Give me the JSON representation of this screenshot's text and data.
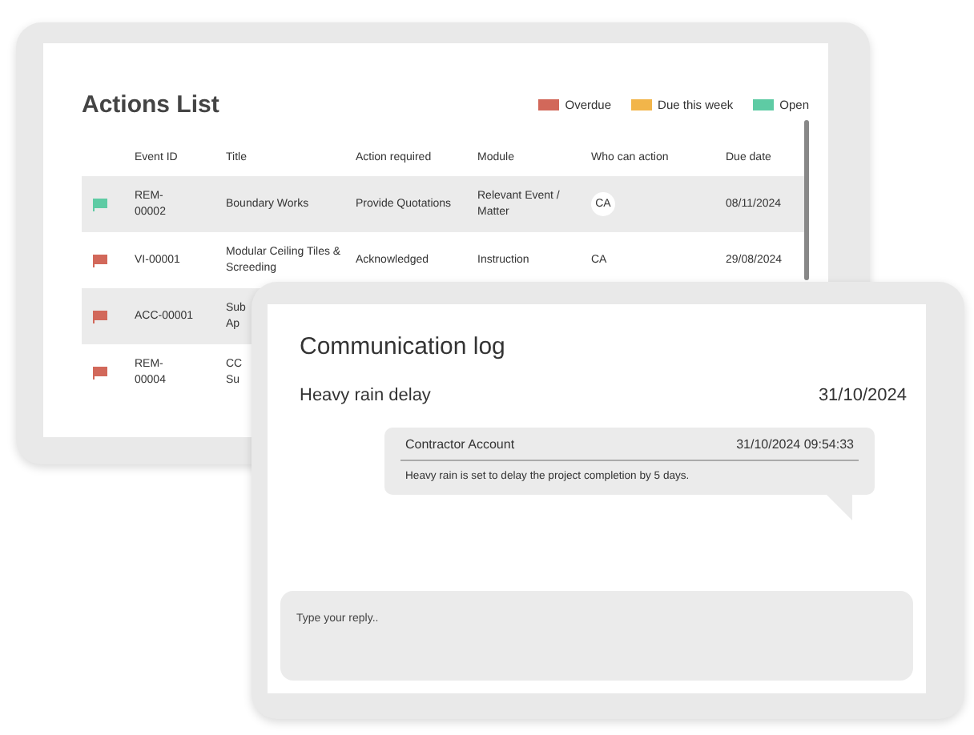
{
  "actions_list": {
    "title": "Actions List",
    "legend": [
      {
        "label": "Overdue",
        "color": "#d2685a"
      },
      {
        "label": "Due this week",
        "color": "#f2b54a"
      },
      {
        "label": "Open",
        "color": "#5ecba4"
      }
    ],
    "columns": [
      "Event ID",
      "Title",
      "Action required",
      "Module",
      "Who can action",
      "Due date"
    ],
    "rows": [
      {
        "color": "#5ecba4",
        "event_id": "REM-\n00002",
        "title": "Boundary Works",
        "action": "Provide Quotations",
        "module": "Relevant Event / Matter",
        "who": "CA",
        "who_badge": true,
        "due": "08/11/2024"
      },
      {
        "color": "#d2685a",
        "event_id": "VI-00001",
        "title": "Modular Ceiling Tiles & Screeding",
        "action": "Acknowledged",
        "module": "Instruction",
        "who": "CA",
        "who_badge": false,
        "due": "29/08/2024"
      },
      {
        "color": "#d2685a",
        "event_id": "ACC-00001",
        "title": "Sub\nAp"
      },
      {
        "color": "#d2685a",
        "event_id": "REM-\n00004",
        "title": "CC\nSu"
      }
    ]
  },
  "communication_log": {
    "title": "Communication log",
    "subject": "Heavy rain delay",
    "date": "31/10/2024",
    "messages": [
      {
        "author": "Contractor Account",
        "timestamp": "31/10/2024 09:54:33",
        "text": "Heavy rain is set to delay the project completion by 5 days."
      }
    ],
    "reply": {
      "placeholder": "Type your reply.."
    }
  }
}
